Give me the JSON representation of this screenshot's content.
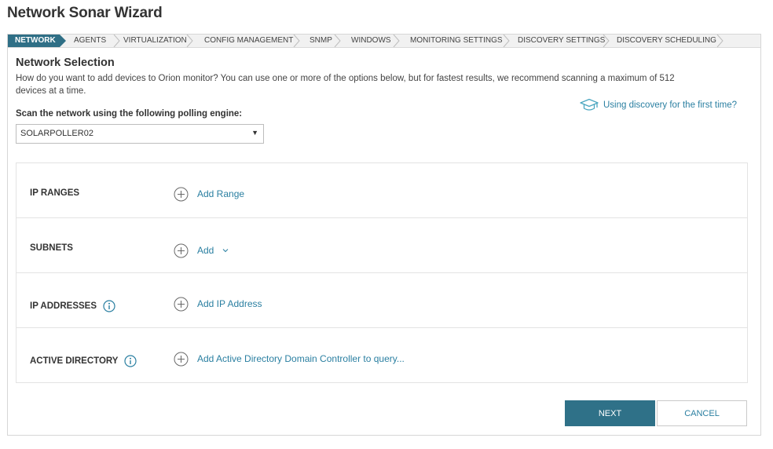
{
  "page": {
    "title": "Network Sonar Wizard"
  },
  "steps": [
    {
      "label": "NETWORK",
      "active": true
    },
    {
      "label": "AGENTS",
      "active": false
    },
    {
      "label": "VIRTUALIZATION",
      "active": false
    },
    {
      "label": "CONFIG MANAGEMENT",
      "active": false
    },
    {
      "label": "SNMP",
      "active": false
    },
    {
      "label": "WINDOWS",
      "active": false
    },
    {
      "label": "MONITORING SETTINGS",
      "active": false
    },
    {
      "label": "DISCOVERY SETTINGS",
      "active": false
    },
    {
      "label": "DISCOVERY SCHEDULING",
      "active": false
    }
  ],
  "network_selection": {
    "heading": "Network Selection",
    "intro": "How do you want to add devices to Orion monitor? You can use one or more of the options below, but for fastest results, we recommend scanning a maximum of 512 devices at a time.",
    "help_link": "Using discovery for the first time?",
    "help_icon": "graduation-cap-icon",
    "engine_label": "Scan the network using the following polling engine:",
    "engine_value": "SOLARPOLLER02"
  },
  "sections": [
    {
      "label": "IP RANGES",
      "action": "Add Range",
      "info": false,
      "dropdown": false
    },
    {
      "label": "SUBNETS",
      "action": "Add",
      "info": false,
      "dropdown": true
    },
    {
      "label": "IP ADDRESSES",
      "action": "Add IP Address",
      "info": true,
      "dropdown": false
    },
    {
      "label": "ACTIVE DIRECTORY",
      "action": "Add Active Directory Domain Controller to query...",
      "info": true,
      "dropdown": false
    }
  ],
  "buttons": {
    "next": "NEXT",
    "cancel": "CANCEL"
  },
  "colors": {
    "accent": "#2f6f86",
    "link": "#2a7fa1",
    "border": "#d6d6d6"
  }
}
